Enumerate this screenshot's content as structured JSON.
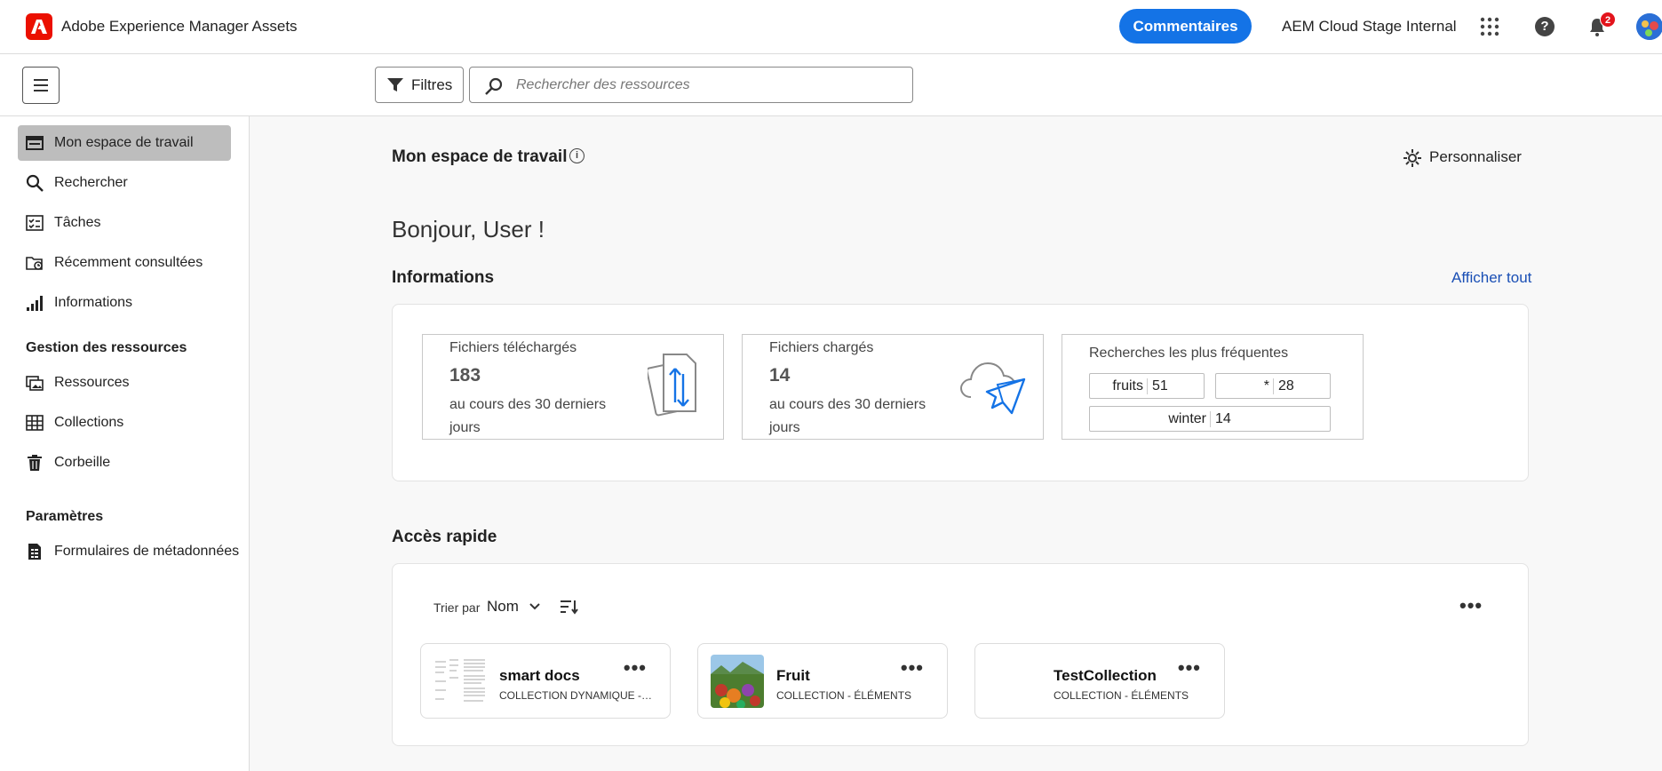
{
  "app": {
    "title": "Adobe Experience Manager Assets"
  },
  "header": {
    "feedback_label": "Commentaires",
    "org_name": "AEM Cloud Stage Internal",
    "notification_count": "2",
    "help_glyph": "?"
  },
  "toolbar": {
    "filters_label": "Filtres",
    "search_placeholder": "Rechercher des ressources"
  },
  "sidebar": {
    "items": [
      {
        "label": "Mon espace de travail",
        "icon": "workspace-icon",
        "active": true
      },
      {
        "label": "Rechercher",
        "icon": "search-icon"
      },
      {
        "label": "Tâches",
        "icon": "tasks-icon"
      },
      {
        "label": "Récemment consultées",
        "icon": "recent-folder-icon"
      },
      {
        "label": "Informations",
        "icon": "chart-bars-icon"
      }
    ],
    "section_assets": "Gestion des ressources",
    "asset_items": [
      {
        "label": "Ressources",
        "icon": "assets-icon"
      },
      {
        "label": "Collections",
        "icon": "collections-grid-icon"
      },
      {
        "label": "Corbeille",
        "icon": "trash-icon"
      }
    ],
    "section_settings": "Paramètres",
    "settings_items": [
      {
        "label": "Formulaires de métadonnées",
        "icon": "metadata-form-icon"
      }
    ]
  },
  "main": {
    "title": "Mon espace de travail",
    "info_glyph": "i",
    "customize_label": "Personnaliser",
    "greeting": "Bonjour, User !",
    "insights": {
      "heading": "Informations",
      "view_all": "Afficher tout",
      "downloaded": {
        "title": "Fichiers téléchargés",
        "value": "183",
        "period": "au cours des 30 derniers jours"
      },
      "uploaded": {
        "title": "Fichiers chargés",
        "value": "14",
        "period": "au cours des 30 derniers jours"
      },
      "top_searches": {
        "title": "Recherches les plus fréquentes",
        "terms": [
          {
            "term": "fruits",
            "count": "51"
          },
          {
            "term": "*",
            "count": "28"
          },
          {
            "term": "winter",
            "count": "14"
          }
        ]
      }
    },
    "quick_access": {
      "heading": "Accès rapide",
      "sort_label": "Trier par",
      "sort_value": "Nom",
      "items": [
        {
          "name": "smart docs",
          "type": "COLLECTION DYNAMIQUE - ÉLÉMENTS"
        },
        {
          "name": "Fruit",
          "type": "COLLECTION - ÉLÉMENTS"
        },
        {
          "name": "TestCollection",
          "type": "COLLECTION - ÉLÉMENTS"
        }
      ]
    }
  },
  "colors": {
    "accent": "#1473e6",
    "brand": "#eb1000",
    "link": "#1a4fb5",
    "active_nav": "#bdbdbd",
    "badge": "#e3141c"
  }
}
